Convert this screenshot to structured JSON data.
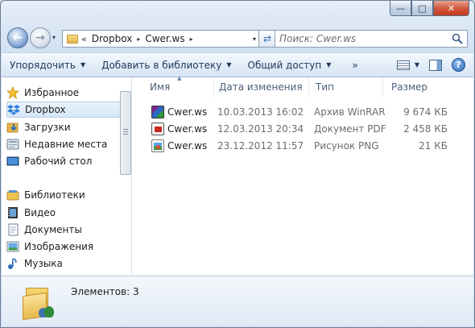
{
  "window": {
    "caption_buttons": {
      "minimize": "—",
      "maximize": "□",
      "close": "✕"
    }
  },
  "navbar": {
    "back_glyph": "←",
    "forward_glyph": "→",
    "history_glyph": "▾",
    "overflow_chevron": "«",
    "breadcrumbs": [
      "Dropbox",
      "Cwer.ws"
    ],
    "crumb_separator": "▸",
    "address_dropdown": "▾",
    "refresh_glyph": "⇄",
    "search_placeholder": "Поиск: Cwer.ws"
  },
  "toolbar": {
    "organize": "Упорядочить",
    "add_library": "Добавить в библиотеку",
    "share": "Общий доступ",
    "more": "»",
    "dropdown_arrow": "▼",
    "help": "?"
  },
  "navpane": {
    "favorites": "Избранное",
    "items": [
      "Dropbox",
      "Загрузки",
      "Недавние места",
      "Рабочий стол"
    ],
    "libraries": "Библиотеки",
    "library_items": [
      "Видео",
      "Документы",
      "Изображения",
      "Музыка"
    ],
    "selected": "Dropbox"
  },
  "filelist": {
    "columns": [
      "Имя",
      "Дата изменения",
      "Тип",
      "Размер"
    ],
    "sort_indicator": "▲",
    "rows": [
      {
        "name": "Cwer.ws",
        "date": "10.03.2013 16:02",
        "type": "Архив WinRAR",
        "size": "9 674 КБ",
        "icon": "winrar-archive-icon"
      },
      {
        "name": "Cwer.ws",
        "date": "12.03.2013 20:34",
        "type": "Документ PDF",
        "size": "2 458 КБ",
        "icon": "pdf-document-icon"
      },
      {
        "name": "Cwer.ws",
        "date": "23.12.2012 11:57",
        "type": "Рисунок PNG",
        "size": "21 КБ",
        "icon": "png-image-icon"
      }
    ]
  },
  "details": {
    "count_label": "Элементов: 3"
  },
  "colors": {
    "accent": "#3399ff",
    "window_frame": "#c9d9ec",
    "selection": "#d7e7f9"
  }
}
